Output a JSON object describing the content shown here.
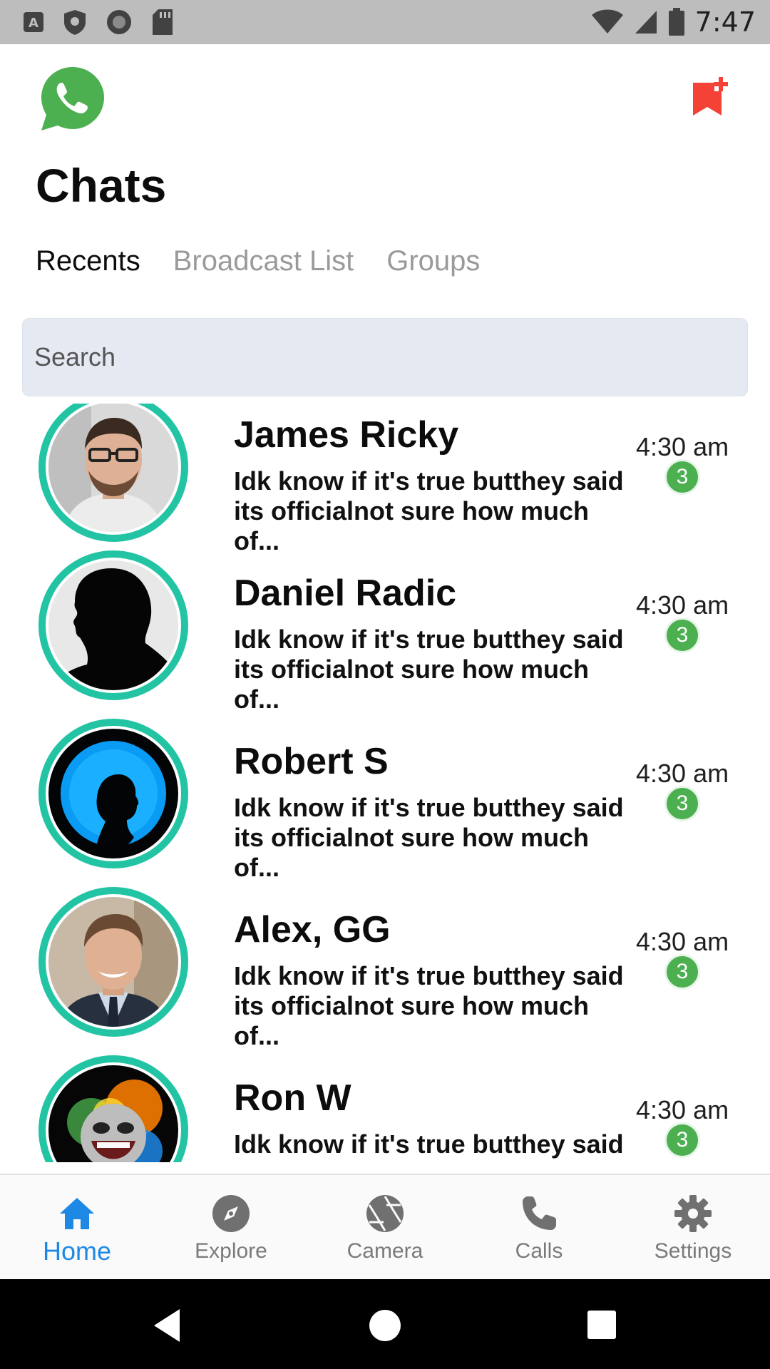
{
  "status_bar": {
    "time": "7:47",
    "left_icons": [
      "a-badge-icon",
      "shield-icon",
      "circle-record-icon",
      "sd-card-icon"
    ],
    "right_icons": [
      "wifi-icon",
      "signal-icon",
      "battery-icon"
    ]
  },
  "header": {
    "title": "Chats",
    "logo_icon": "whatsapp-logo-icon",
    "action_icon": "bookmark-add-icon",
    "action_color": "#f44336"
  },
  "tabs": [
    {
      "label": "Recents",
      "active": true
    },
    {
      "label": "Broadcast List",
      "active": false
    },
    {
      "label": "Groups",
      "active": false
    }
  ],
  "search": {
    "placeholder": "Search",
    "value": ""
  },
  "chats": [
    {
      "name": "James Ricky",
      "message": "Idk know if it's true butthey said its officialnot sure how much of...",
      "time": "4:30 am",
      "unread": "3",
      "avatar": "man-glasses-photo"
    },
    {
      "name": "Daniel Radic",
      "message": "Idk know if it's true butthey said its officialnot sure how much of...",
      "time": "4:30 am",
      "unread": "3",
      "avatar": "silhouette-glasses-photo"
    },
    {
      "name": "Robert S",
      "message": "Idk know if it's true butthey said its officialnot sure how much of...",
      "time": "4:30 am",
      "unread": "3",
      "avatar": "blue-silhouette-photo"
    },
    {
      "name": "Alex, GG",
      "message": "Idk know if it's true butthey said its officialnot sure how much of...",
      "time": "4:30 am",
      "unread": "3",
      "avatar": "man-suit-photo"
    },
    {
      "name": "Ron W",
      "message": "Idk know if it's true butthey said its officialnot sure how much of...",
      "time": "4:30 am",
      "unread": "3",
      "avatar": "colorful-smiley-photo"
    }
  ],
  "bottom_nav": [
    {
      "label": "Home",
      "icon": "home-icon",
      "active": true
    },
    {
      "label": "Explore",
      "icon": "compass-icon",
      "active": false
    },
    {
      "label": "Camera",
      "icon": "camera-aperture-icon",
      "active": false
    },
    {
      "label": "Calls",
      "icon": "phone-icon",
      "active": false
    },
    {
      "label": "Settings",
      "icon": "gear-icon",
      "active": false
    }
  ],
  "colors": {
    "accent": "#1e88e5",
    "avatar_ring": "#23c4a4",
    "badge": "#4caf50",
    "whatsapp": "#4caf50"
  }
}
